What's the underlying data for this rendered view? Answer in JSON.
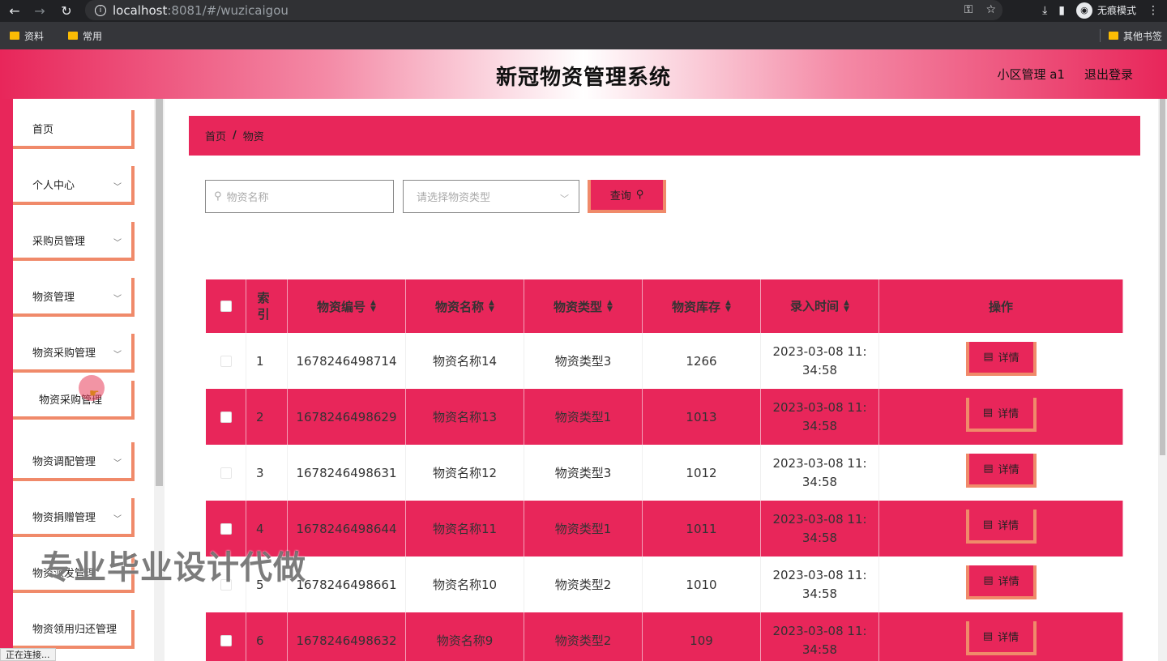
{
  "browser": {
    "url_host": "localhost",
    "url_rest": ":8081/#/wuzicaigou",
    "incognito_label": "无痕模式",
    "bookmarks": [
      "资料",
      "常用"
    ],
    "other_bookmarks": "其他书签",
    "status_text": "正在连接..."
  },
  "header": {
    "title": "新冠物资管理系统",
    "user": "小区管理 a1",
    "logout": "退出登录"
  },
  "sidebar": {
    "items": [
      {
        "label": "首页"
      },
      {
        "label": "个人中心"
      },
      {
        "label": "采购员管理"
      },
      {
        "label": "物资管理"
      },
      {
        "label": "物资采购管理"
      },
      {
        "label": "物资采购管理"
      },
      {
        "label": "物资调配管理"
      },
      {
        "label": "物资捐赠管理"
      },
      {
        "label": "物资派发管理"
      },
      {
        "label": "物资领用归还管理"
      }
    ]
  },
  "breadcrumb": [
    "首页",
    "物资"
  ],
  "filters": {
    "name_placeholder": "物资名称",
    "type_placeholder": "请选择物资类型",
    "query_label": "查询"
  },
  "table": {
    "columns": [
      "索引",
      "物资编号",
      "物资名称",
      "物资类型",
      "物资库存",
      "录入时间",
      "操作"
    ],
    "rows": [
      {
        "index": "1",
        "code": "1678246498714",
        "name": "物资名称14",
        "type": "物资类型3",
        "stock": "1266",
        "time1": "2023-03-08 11:",
        "time2": "34:58"
      },
      {
        "index": "2",
        "code": "1678246498629",
        "name": "物资名称13",
        "type": "物资类型1",
        "stock": "1013",
        "time1": "2023-03-08 11:",
        "time2": "34:58"
      },
      {
        "index": "3",
        "code": "1678246498631",
        "name": "物资名称12",
        "type": "物资类型3",
        "stock": "1012",
        "time1": "2023-03-08 11:",
        "time2": "34:58"
      },
      {
        "index": "4",
        "code": "1678246498644",
        "name": "物资名称11",
        "type": "物资类型1",
        "stock": "1011",
        "time1": "2023-03-08 11:",
        "time2": "34:58"
      },
      {
        "index": "5",
        "code": "1678246498661",
        "name": "物资名称10",
        "type": "物资类型2",
        "stock": "1010",
        "time1": "2023-03-08 11:",
        "time2": "34:58"
      },
      {
        "index": "6",
        "code": "1678246498632",
        "name": "物资名称9",
        "type": "物资类型2",
        "stock": "109",
        "time1": "2023-03-08 11:",
        "time2": "34:58"
      }
    ],
    "detail_label": "详情"
  },
  "watermark": "专业毕业设计代做"
}
